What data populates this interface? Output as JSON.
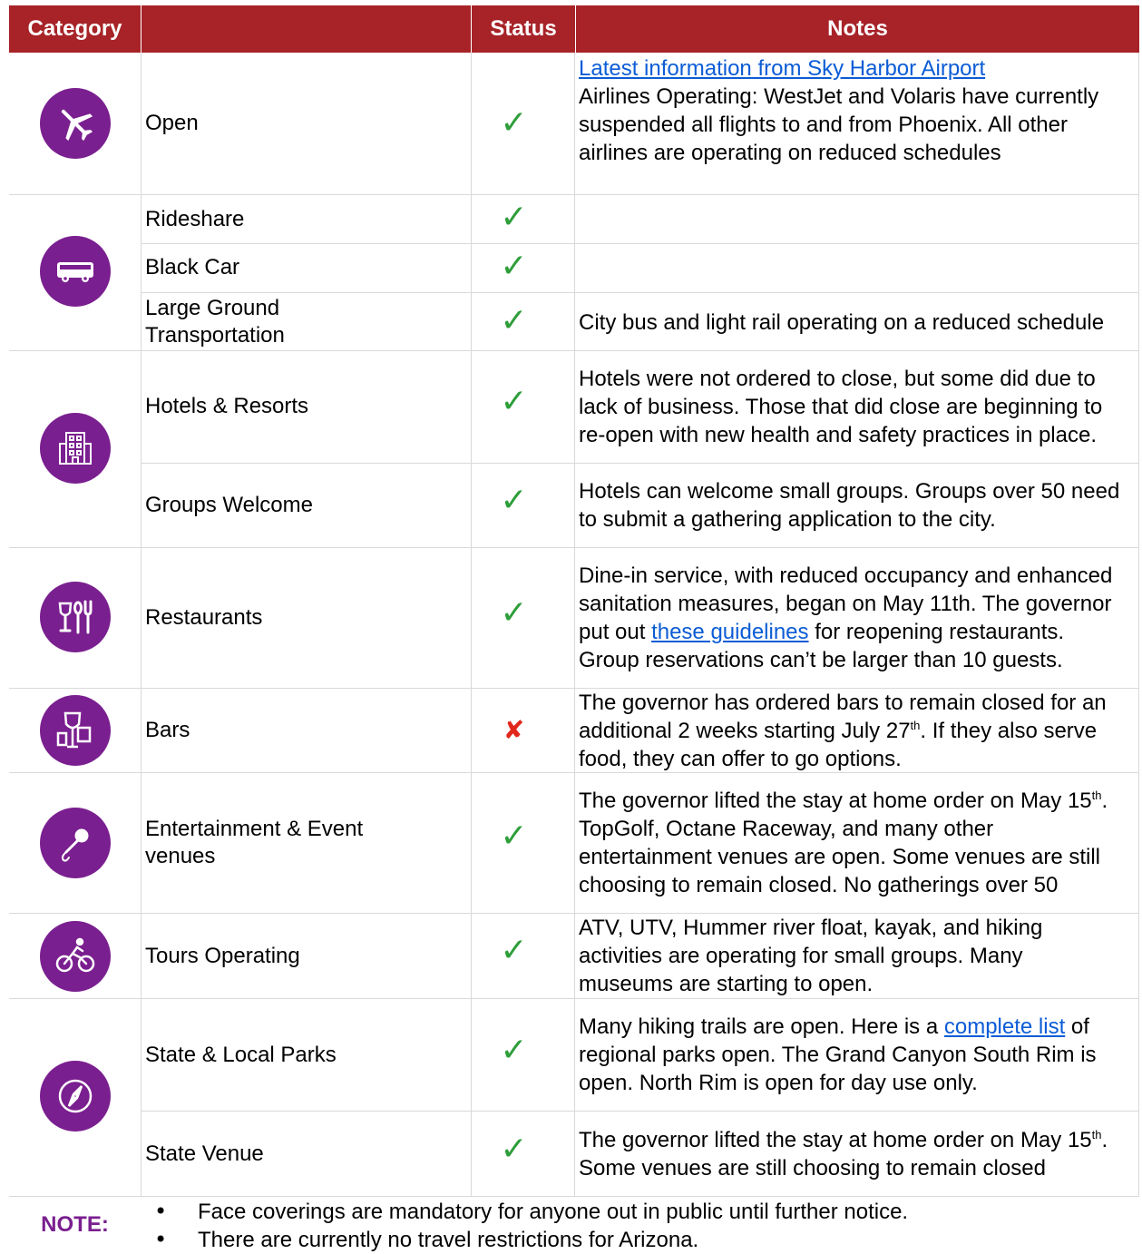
{
  "headers": {
    "category": "Category",
    "status": "Status",
    "notes": "Notes"
  },
  "colors": {
    "header_bg": "#a72328",
    "icon_bg": "#7a1f8f",
    "check": "#2e9e3a",
    "cross": "#e1261c",
    "link": "#0b5cd6"
  },
  "rows": [
    {
      "icon": "airplane-icon",
      "category": "Open",
      "status": "open",
      "notes_link": "Latest information from Sky Harbor Airport",
      "notes": "Airlines Operating: WestJet and Volaris have currently suspended all flights to and from Phoenix. All other airlines are operating on reduced schedules"
    },
    {
      "icon": "bus-icon",
      "category": "Rideshare",
      "status": "open",
      "notes": ""
    },
    {
      "category": "Black Car",
      "status": "open",
      "notes": ""
    },
    {
      "category": "Large Ground Transportation",
      "status": "open",
      "notes": "City bus and light rail operating on a reduced schedule"
    },
    {
      "icon": "hotel-building-icon",
      "category": "Hotels & Resorts",
      "status": "open",
      "notes": "Hotels were not ordered to close, but some did due to lack of business.  Those that did close are beginning to re-open with new health and safety practices in place."
    },
    {
      "category": "Groups Welcome",
      "status": "open",
      "notes": "Hotels can welcome small groups. Groups over 50 need to submit a gathering application to the city."
    },
    {
      "icon": "dining-icon",
      "category": "Restaurants",
      "status": "open",
      "notes_a": "Dine-in service, with reduced occupancy and enhanced sanitation measures, began on May 11th. The governor put out ",
      "notes_link": "these guidelines",
      "notes_b": " for reopening restaurants. Group reservations can’t be larger than 10 guests."
    },
    {
      "icon": "drinks-icon",
      "category": "Bars",
      "status": "closed",
      "notes_a": "The governor has ordered bars to remain closed for an additional 2 weeks starting July 27",
      "notes_sup": "th",
      "notes_b": ". If they also serve food, they can offer to go options."
    },
    {
      "icon": "microphone-icon",
      "category": "Entertainment & Event venues",
      "status": "open",
      "notes_a": "The governor lifted the stay at home order on May 15",
      "notes_sup": "th",
      "notes_b": ". TopGolf, Octane Raceway, and many other entertainment venues are open. Some venues are still choosing to remain closed. No gatherings over 50"
    },
    {
      "icon": "cyclist-icon",
      "category": "Tours Operating",
      "status": "open",
      "notes": "ATV, UTV, Hummer river float, kayak, and hiking activities are operating for small groups. Many museums are starting to open."
    },
    {
      "icon": "compass-icon",
      "category": "State & Local Parks",
      "status": "open",
      "notes_a": "Many hiking trails are open. Here is a ",
      "notes_link": "complete list",
      "notes_b": " of regional parks open. The Grand Canyon South Rim is open. North Rim is open for day use only."
    },
    {
      "category": "State Venue",
      "status": "open",
      "notes_a": "The governor lifted the stay at home order on May 15",
      "notes_sup": "th",
      "notes_b": ". Some venues are still choosing to remain closed"
    }
  ],
  "status_marks": {
    "open": "✓",
    "closed": "✘"
  },
  "note": {
    "label": "NOTE:",
    "bullet": "•",
    "items": [
      "Face coverings are mandatory for anyone out in public until further notice.",
      "There are currently no travel restrictions for Arizona."
    ]
  }
}
